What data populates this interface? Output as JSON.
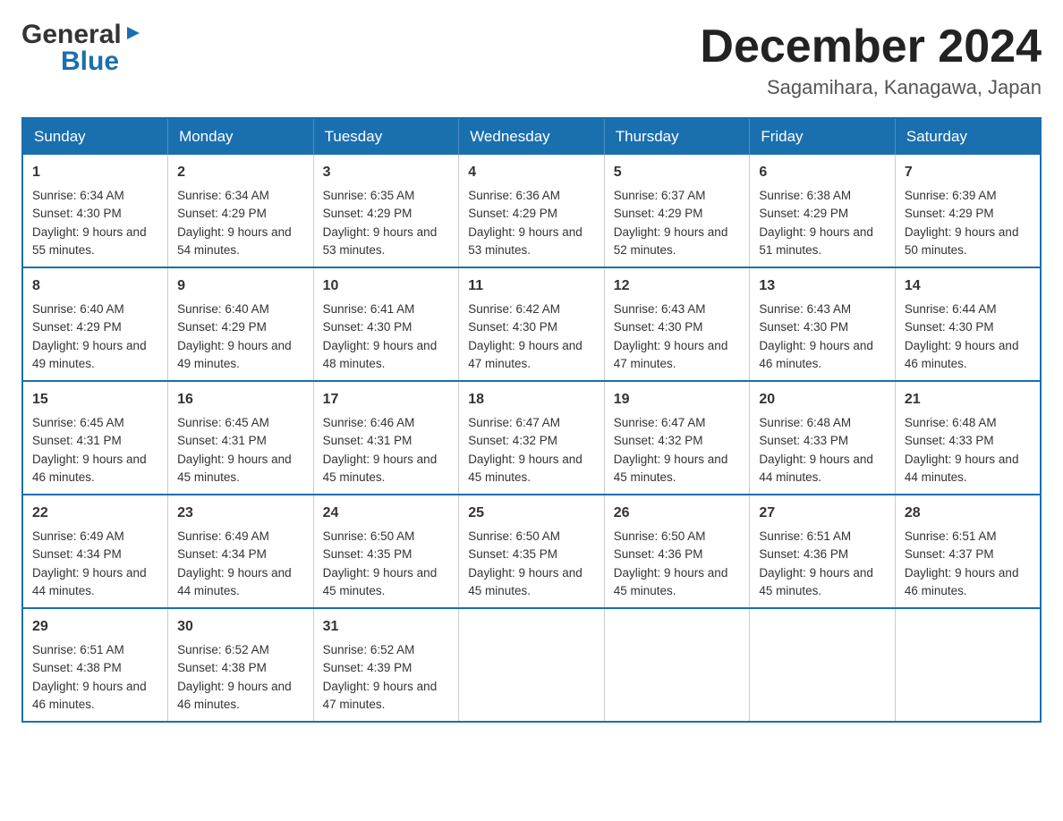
{
  "header": {
    "title": "December 2024",
    "location": "Sagamihara, Kanagawa, Japan",
    "logo_general": "General",
    "logo_blue": "Blue"
  },
  "calendar": {
    "days_of_week": [
      "Sunday",
      "Monday",
      "Tuesday",
      "Wednesday",
      "Thursday",
      "Friday",
      "Saturday"
    ],
    "weeks": [
      [
        {
          "day": "1",
          "sunrise": "6:34 AM",
          "sunset": "4:30 PM",
          "daylight": "9 hours and 55 minutes."
        },
        {
          "day": "2",
          "sunrise": "6:34 AM",
          "sunset": "4:29 PM",
          "daylight": "9 hours and 54 minutes."
        },
        {
          "day": "3",
          "sunrise": "6:35 AM",
          "sunset": "4:29 PM",
          "daylight": "9 hours and 53 minutes."
        },
        {
          "day": "4",
          "sunrise": "6:36 AM",
          "sunset": "4:29 PM",
          "daylight": "9 hours and 53 minutes."
        },
        {
          "day": "5",
          "sunrise": "6:37 AM",
          "sunset": "4:29 PM",
          "daylight": "9 hours and 52 minutes."
        },
        {
          "day": "6",
          "sunrise": "6:38 AM",
          "sunset": "4:29 PM",
          "daylight": "9 hours and 51 minutes."
        },
        {
          "day": "7",
          "sunrise": "6:39 AM",
          "sunset": "4:29 PM",
          "daylight": "9 hours and 50 minutes."
        }
      ],
      [
        {
          "day": "8",
          "sunrise": "6:40 AM",
          "sunset": "4:29 PM",
          "daylight": "9 hours and 49 minutes."
        },
        {
          "day": "9",
          "sunrise": "6:40 AM",
          "sunset": "4:29 PM",
          "daylight": "9 hours and 49 minutes."
        },
        {
          "day": "10",
          "sunrise": "6:41 AM",
          "sunset": "4:30 PM",
          "daylight": "9 hours and 48 minutes."
        },
        {
          "day": "11",
          "sunrise": "6:42 AM",
          "sunset": "4:30 PM",
          "daylight": "9 hours and 47 minutes."
        },
        {
          "day": "12",
          "sunrise": "6:43 AM",
          "sunset": "4:30 PM",
          "daylight": "9 hours and 47 minutes."
        },
        {
          "day": "13",
          "sunrise": "6:43 AM",
          "sunset": "4:30 PM",
          "daylight": "9 hours and 46 minutes."
        },
        {
          "day": "14",
          "sunrise": "6:44 AM",
          "sunset": "4:30 PM",
          "daylight": "9 hours and 46 minutes."
        }
      ],
      [
        {
          "day": "15",
          "sunrise": "6:45 AM",
          "sunset": "4:31 PM",
          "daylight": "9 hours and 46 minutes."
        },
        {
          "day": "16",
          "sunrise": "6:45 AM",
          "sunset": "4:31 PM",
          "daylight": "9 hours and 45 minutes."
        },
        {
          "day": "17",
          "sunrise": "6:46 AM",
          "sunset": "4:31 PM",
          "daylight": "9 hours and 45 minutes."
        },
        {
          "day": "18",
          "sunrise": "6:47 AM",
          "sunset": "4:32 PM",
          "daylight": "9 hours and 45 minutes."
        },
        {
          "day": "19",
          "sunrise": "6:47 AM",
          "sunset": "4:32 PM",
          "daylight": "9 hours and 45 minutes."
        },
        {
          "day": "20",
          "sunrise": "6:48 AM",
          "sunset": "4:33 PM",
          "daylight": "9 hours and 44 minutes."
        },
        {
          "day": "21",
          "sunrise": "6:48 AM",
          "sunset": "4:33 PM",
          "daylight": "9 hours and 44 minutes."
        }
      ],
      [
        {
          "day": "22",
          "sunrise": "6:49 AM",
          "sunset": "4:34 PM",
          "daylight": "9 hours and 44 minutes."
        },
        {
          "day": "23",
          "sunrise": "6:49 AM",
          "sunset": "4:34 PM",
          "daylight": "9 hours and 44 minutes."
        },
        {
          "day": "24",
          "sunrise": "6:50 AM",
          "sunset": "4:35 PM",
          "daylight": "9 hours and 45 minutes."
        },
        {
          "day": "25",
          "sunrise": "6:50 AM",
          "sunset": "4:35 PM",
          "daylight": "9 hours and 45 minutes."
        },
        {
          "day": "26",
          "sunrise": "6:50 AM",
          "sunset": "4:36 PM",
          "daylight": "9 hours and 45 minutes."
        },
        {
          "day": "27",
          "sunrise": "6:51 AM",
          "sunset": "4:36 PM",
          "daylight": "9 hours and 45 minutes."
        },
        {
          "day": "28",
          "sunrise": "6:51 AM",
          "sunset": "4:37 PM",
          "daylight": "9 hours and 46 minutes."
        }
      ],
      [
        {
          "day": "29",
          "sunrise": "6:51 AM",
          "sunset": "4:38 PM",
          "daylight": "9 hours and 46 minutes."
        },
        {
          "day": "30",
          "sunrise": "6:52 AM",
          "sunset": "4:38 PM",
          "daylight": "9 hours and 46 minutes."
        },
        {
          "day": "31",
          "sunrise": "6:52 AM",
          "sunset": "4:39 PM",
          "daylight": "9 hours and 47 minutes."
        },
        null,
        null,
        null,
        null
      ]
    ],
    "sunrise_label": "Sunrise:",
    "sunset_label": "Sunset:",
    "daylight_label": "Daylight:"
  }
}
